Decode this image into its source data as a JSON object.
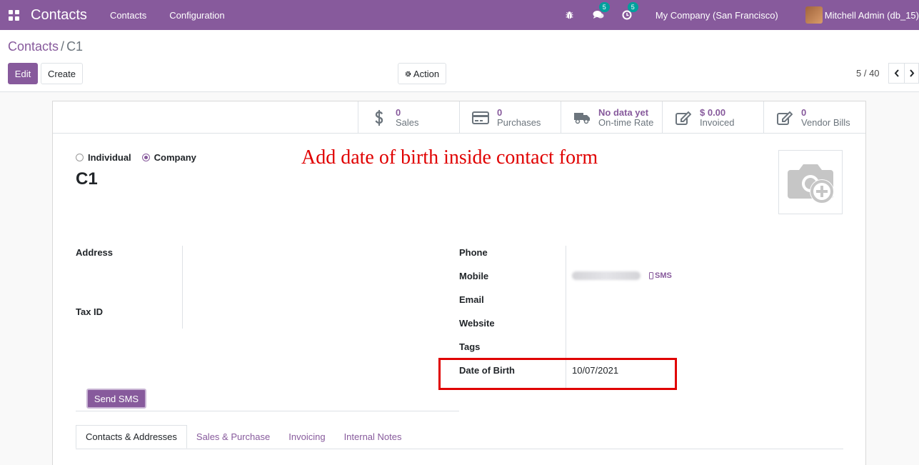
{
  "navbar": {
    "app_name": "Contacts",
    "menus": [
      "Contacts",
      "Configuration"
    ],
    "chat_badge": "5",
    "activity_badge": "5",
    "company": "My Company (San Francisco)",
    "user": "Mitchell Admin (db_15)"
  },
  "breadcrumb": {
    "parent": "Contacts",
    "separator": "/",
    "current": "C1"
  },
  "buttons": {
    "edit": "Edit",
    "create": "Create",
    "action": "Action"
  },
  "pager": {
    "value": "5 / 40"
  },
  "stat_buttons": [
    {
      "value": "0",
      "label": "Sales",
      "icon": "dollar-icon"
    },
    {
      "value": "0",
      "label": "Purchases",
      "icon": "credit-card-icon"
    },
    {
      "value": "No data yet",
      "label": "On-time Rate",
      "icon": "truck-icon"
    },
    {
      "value": "$ 0.00",
      "label": "Invoiced",
      "icon": "pencil-square-icon"
    },
    {
      "value": "0",
      "label": "Vendor Bills",
      "icon": "pencil-square-icon"
    }
  ],
  "company_type": {
    "options": [
      "Individual",
      "Company"
    ],
    "selected": "Company"
  },
  "record": {
    "name": "C1"
  },
  "annotation": "Add date of birth inside contact form",
  "left_fields": {
    "address": "Address",
    "tax_id": "Tax ID"
  },
  "right_fields": {
    "phone": "Phone",
    "mobile": "Mobile",
    "email": "Email",
    "website": "Website",
    "tags": "Tags",
    "date_of_birth": "Date of Birth",
    "date_of_birth_value": "10/07/2021",
    "sms_link": "SMS"
  },
  "send_sms_button": "Send SMS",
  "tabs": [
    "Contacts & Addresses",
    "Sales & Purchase",
    "Invoicing",
    "Internal Notes"
  ],
  "colors": {
    "brand": "#875a9c",
    "annotation": "#e00000",
    "badge": "#00a09d"
  }
}
